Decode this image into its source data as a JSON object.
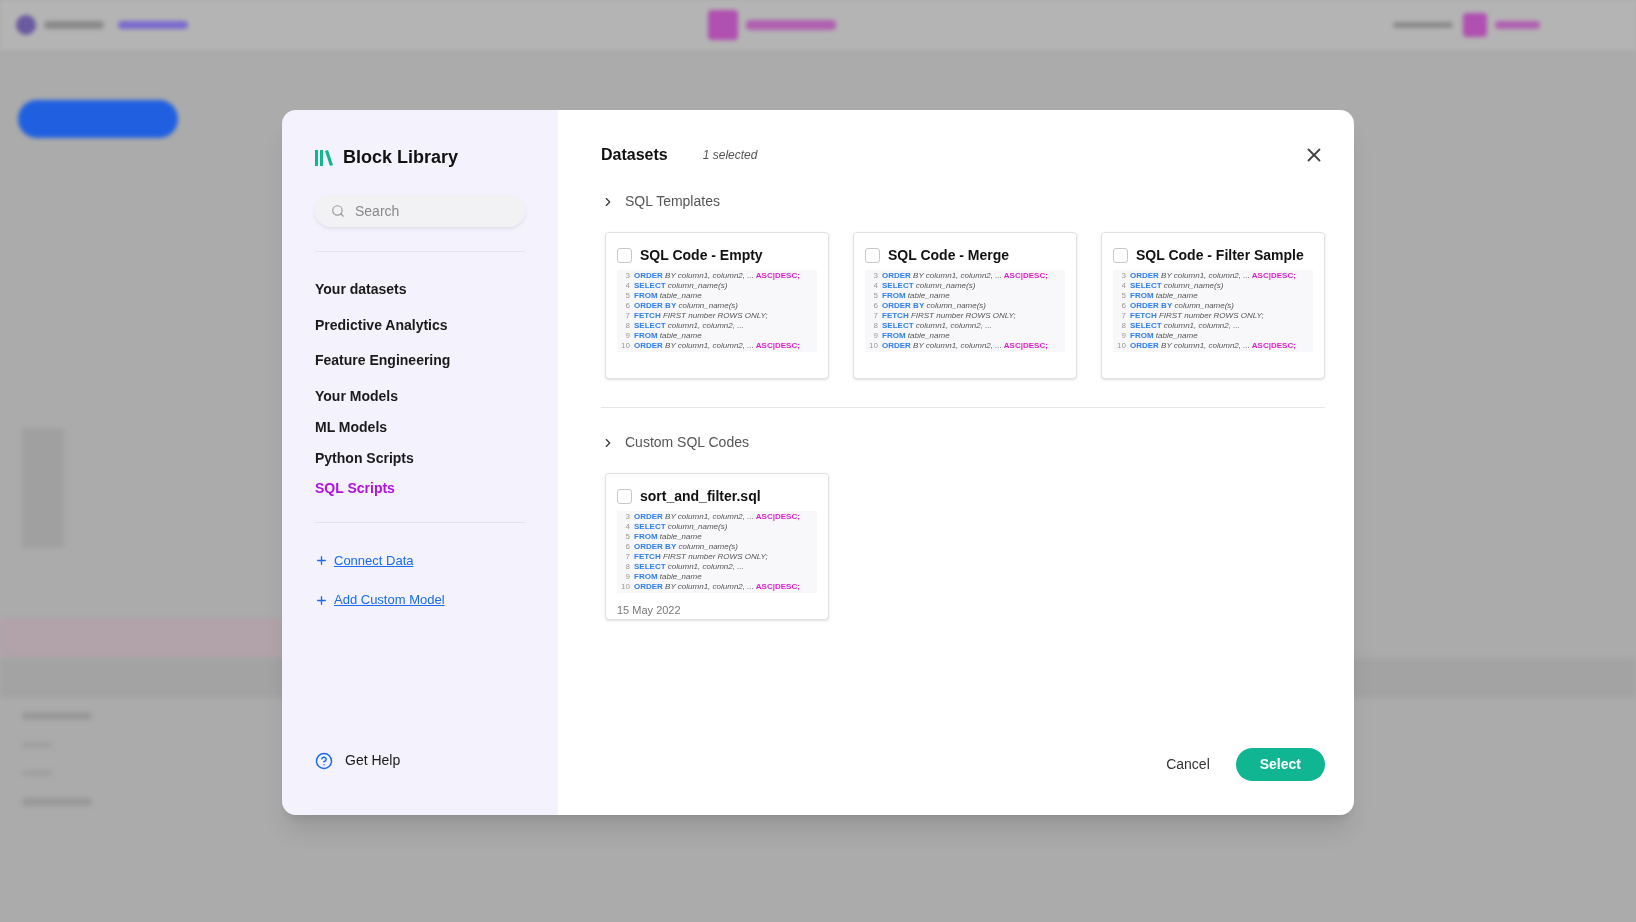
{
  "sidebar": {
    "title": "Block Library",
    "search": {
      "placeholder": "Search"
    },
    "items": [
      {
        "label": "Your datasets",
        "selected": false
      },
      {
        "label": "Predictive Analytics",
        "selected": false
      },
      {
        "label": "Feature Engineering",
        "selected": false
      },
      {
        "label": "Your Models",
        "selected": false
      },
      {
        "label": "ML Models",
        "selected": false
      },
      {
        "label": "Python Scripts",
        "selected": false
      },
      {
        "label": "SQL Scripts",
        "selected": true
      }
    ],
    "links": [
      "Connect Data",
      "Add Custom Model"
    ],
    "help": "Get Help"
  },
  "header": {
    "title": "Datasets",
    "count": "1 selected"
  },
  "sections": [
    {
      "title": "SQL Templates",
      "expanded": false,
      "cards": [
        {
          "title": "SQL Code - Empty",
          "checked": false,
          "lines": [
            {
              "num": "3",
              "parts": [
                {
                  "kind": "keyword",
                  "text": "ORDER"
                },
                {
                  "kind": "plain",
                  "text": "BY column1, column2, ..."
                },
                {
                  "kind": "accent",
                  "text": "ASC|DESC;"
                }
              ]
            },
            {
              "num": "4",
              "parts": [
                {
                  "kind": "keyword",
                  "text": "SELECT"
                },
                {
                  "kind": "plain",
                  "text": "column_name(s)"
                }
              ]
            },
            {
              "num": "5",
              "parts": [
                {
                  "kind": "keyword",
                  "text": "FROM"
                },
                {
                  "kind": "plain",
                  "text": "table_name"
                }
              ]
            },
            {
              "num": "6",
              "parts": [
                {
                  "kind": "keyword",
                  "text": "ORDER BY"
                },
                {
                  "kind": "plain",
                  "text": "column_name(s)"
                }
              ]
            },
            {
              "num": "7",
              "parts": [
                {
                  "kind": "keyword",
                  "text": "FETCH"
                },
                {
                  "kind": "plain",
                  "text": "FIRST number ROWS ONLY;"
                }
              ]
            },
            {
              "num": "8",
              "parts": [
                {
                  "kind": "keyword",
                  "text": "SELECT"
                },
                {
                  "kind": "plain",
                  "text": "column1, column2, ..."
                }
              ]
            },
            {
              "num": "9",
              "parts": [
                {
                  "kind": "keyword",
                  "text": "FROM"
                },
                {
                  "kind": "plain",
                  "text": "table_name"
                }
              ]
            },
            {
              "num": "10",
              "parts": [
                {
                  "kind": "keyword",
                  "text": "ORDER"
                },
                {
                  "kind": "plain",
                  "text": "BY column1, column2, ..."
                },
                {
                  "kind": "accent",
                  "text": "ASC|DESC;"
                }
              ]
            }
          ]
        },
        {
          "title": "SQL Code - Merge",
          "checked": false,
          "lines": [
            {
              "num": "3",
              "parts": [
                {
                  "kind": "keyword",
                  "text": "ORDER"
                },
                {
                  "kind": "plain",
                  "text": "BY column1, column2, ..."
                },
                {
                  "kind": "accent",
                  "text": "ASC|DESC;"
                }
              ]
            },
            {
              "num": "4",
              "parts": [
                {
                  "kind": "keyword",
                  "text": "SELECT"
                },
                {
                  "kind": "plain",
                  "text": "column_name(s)"
                }
              ]
            },
            {
              "num": "5",
              "parts": [
                {
                  "kind": "keyword",
                  "text": "FROM"
                },
                {
                  "kind": "plain",
                  "text": "table_name"
                }
              ]
            },
            {
              "num": "6",
              "parts": [
                {
                  "kind": "keyword",
                  "text": "ORDER BY"
                },
                {
                  "kind": "plain",
                  "text": "column_name(s)"
                }
              ]
            },
            {
              "num": "7",
              "parts": [
                {
                  "kind": "keyword",
                  "text": "FETCH"
                },
                {
                  "kind": "plain",
                  "text": "FIRST number ROWS ONLY;"
                }
              ]
            },
            {
              "num": "8",
              "parts": [
                {
                  "kind": "keyword",
                  "text": "SELECT"
                },
                {
                  "kind": "plain",
                  "text": "column1, column2, ..."
                }
              ]
            },
            {
              "num": "9",
              "parts": [
                {
                  "kind": "keyword",
                  "text": "FROM"
                },
                {
                  "kind": "plain",
                  "text": "table_name"
                }
              ]
            },
            {
              "num": "10",
              "parts": [
                {
                  "kind": "keyword",
                  "text": "ORDER"
                },
                {
                  "kind": "plain",
                  "text": "BY column1, column2, ..."
                },
                {
                  "kind": "accent",
                  "text": "ASC|DESC;"
                }
              ]
            }
          ]
        },
        {
          "title": "SQL Code - Filter Sample",
          "checked": false,
          "lines": [
            {
              "num": "3",
              "parts": [
                {
                  "kind": "keyword",
                  "text": "ORDER"
                },
                {
                  "kind": "plain",
                  "text": "BY column1, column2, ..."
                },
                {
                  "kind": "accent",
                  "text": "ASC|DESC;"
                }
              ]
            },
            {
              "num": "4",
              "parts": [
                {
                  "kind": "keyword",
                  "text": "SELECT"
                },
                {
                  "kind": "plain",
                  "text": "column_name(s)"
                }
              ]
            },
            {
              "num": "5",
              "parts": [
                {
                  "kind": "keyword",
                  "text": "FROM"
                },
                {
                  "kind": "plain",
                  "text": "table_name"
                }
              ]
            },
            {
              "num": "6",
              "parts": [
                {
                  "kind": "keyword",
                  "text": "ORDER BY"
                },
                {
                  "kind": "plain",
                  "text": "column_name(s)"
                }
              ]
            },
            {
              "num": "7",
              "parts": [
                {
                  "kind": "keyword",
                  "text": "FETCH"
                },
                {
                  "kind": "plain",
                  "text": "FIRST number ROWS ONLY;"
                }
              ]
            },
            {
              "num": "8",
              "parts": [
                {
                  "kind": "keyword",
                  "text": "SELECT"
                },
                {
                  "kind": "plain",
                  "text": "column1, column2, ..."
                }
              ]
            },
            {
              "num": "9",
              "parts": [
                {
                  "kind": "keyword",
                  "text": "FROM"
                },
                {
                  "kind": "plain",
                  "text": "table_name"
                }
              ]
            },
            {
              "num": "10",
              "parts": [
                {
                  "kind": "keyword",
                  "text": "ORDER"
                },
                {
                  "kind": "plain",
                  "text": "BY column1, column2, ..."
                },
                {
                  "kind": "accent",
                  "text": "ASC|DESC;"
                }
              ]
            }
          ]
        }
      ]
    },
    {
      "title": "Custom SQL Codes",
      "expanded": false,
      "cards": [
        {
          "title": "sort_and_filter.sql",
          "checked": false,
          "date": "15 May 2022",
          "lines": [
            {
              "num": "3",
              "parts": [
                {
                  "kind": "keyword",
                  "text": "ORDER"
                },
                {
                  "kind": "plain",
                  "text": "BY column1, column2, ..."
                },
                {
                  "kind": "accent",
                  "text": "ASC|DESC;"
                }
              ]
            },
            {
              "num": "4",
              "parts": [
                {
                  "kind": "keyword",
                  "text": "SELECT"
                },
                {
                  "kind": "plain",
                  "text": "column_name(s)"
                }
              ]
            },
            {
              "num": "5",
              "parts": [
                {
                  "kind": "keyword",
                  "text": "FROM"
                },
                {
                  "kind": "plain",
                  "text": "table_name"
                }
              ]
            },
            {
              "num": "6",
              "parts": [
                {
                  "kind": "keyword",
                  "text": "ORDER BY"
                },
                {
                  "kind": "plain",
                  "text": "column_name(s)"
                }
              ]
            },
            {
              "num": "7",
              "parts": [
                {
                  "kind": "keyword",
                  "text": "FETCH"
                },
                {
                  "kind": "plain",
                  "text": "FIRST number ROWS ONLY;"
                }
              ]
            },
            {
              "num": "8",
              "parts": [
                {
                  "kind": "keyword",
                  "text": "SELECT"
                },
                {
                  "kind": "plain",
                  "text": "column1, column2, ..."
                }
              ]
            },
            {
              "num": "9",
              "parts": [
                {
                  "kind": "keyword",
                  "text": "FROM"
                },
                {
                  "kind": "plain",
                  "text": "table_name"
                }
              ]
            },
            {
              "num": "10",
              "parts": [
                {
                  "kind": "keyword",
                  "text": "ORDER"
                },
                {
                  "kind": "plain",
                  "text": "BY column1, column2, ..."
                },
                {
                  "kind": "accent",
                  "text": "ASC|DESC;"
                }
              ]
            }
          ]
        }
      ]
    }
  ],
  "buttons": {
    "cancel": "Cancel",
    "select": "Select"
  }
}
